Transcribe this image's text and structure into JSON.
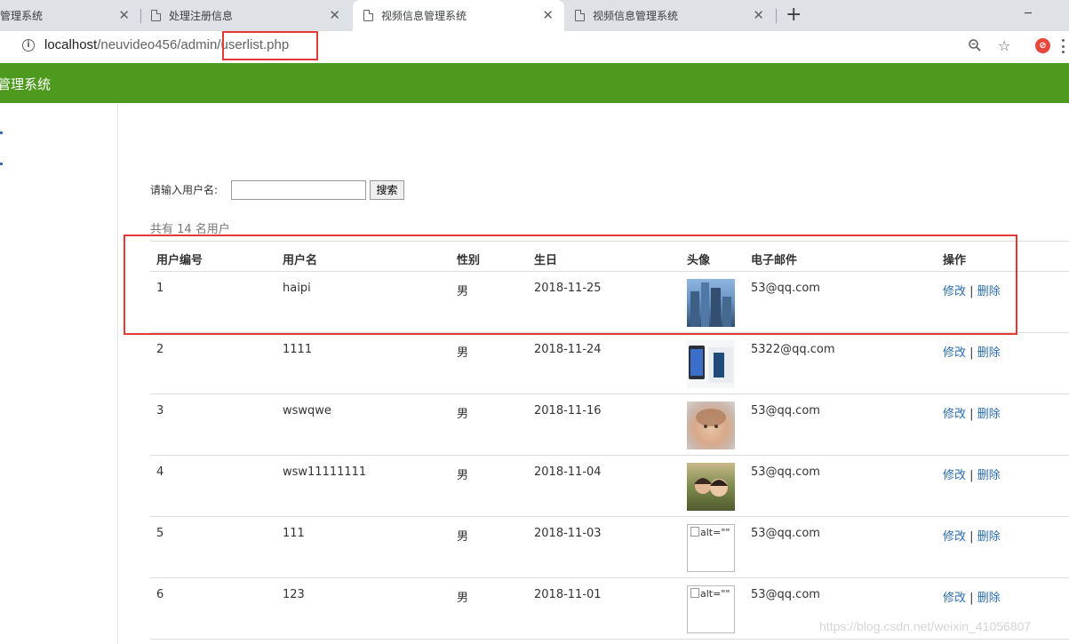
{
  "browser": {
    "tabs": [
      {
        "title": "管理系统",
        "active": false
      },
      {
        "title": "处理注册信息",
        "active": false
      },
      {
        "title": "视频信息管理系统",
        "active": true
      },
      {
        "title": "视频信息管理系统",
        "active": false
      }
    ],
    "url_host": "localhost",
    "url_path": "/neuvideo456/admin/userlist.php"
  },
  "app": {
    "title": "管理系统",
    "header_color": "#4e9a1e"
  },
  "search": {
    "label": "请输入用户名:",
    "value": "",
    "button": "搜索"
  },
  "summary": "共有 14 名用户",
  "table": {
    "headers": [
      "用户编号",
      "用户名",
      "性别",
      "生日",
      "头像",
      "电子邮件",
      "操作"
    ],
    "rows": [
      {
        "id": "1",
        "username": "haipi",
        "gender": "男",
        "birthday": "2018-11-25",
        "avatar": "city-buildings",
        "email": "53@qq.com",
        "edit": "修改",
        "sep": "|",
        "delete": "删除"
      },
      {
        "id": "2",
        "username": "1111",
        "gender": "男",
        "birthday": "2018-11-24",
        "avatar": "phone-screenshot",
        "email": "5322@qq.com",
        "edit": "修改",
        "sep": "|",
        "delete": "删除"
      },
      {
        "id": "3",
        "username": "wswqwe",
        "gender": "男",
        "birthday": "2018-11-16",
        "avatar": "baby-photo",
        "email": "53@qq.com",
        "edit": "修改",
        "sep": "|",
        "delete": "删除"
      },
      {
        "id": "4",
        "username": "wsw11111111",
        "gender": "男",
        "birthday": "2018-11-04",
        "avatar": "girls-outdoor",
        "email": "53@qq.com",
        "edit": "修改",
        "sep": "|",
        "delete": "删除"
      },
      {
        "id": "5",
        "username": "111",
        "gender": "男",
        "birthday": "2018-11-03",
        "avatar_alt": "alt=\"\"",
        "email": "53@qq.com",
        "edit": "修改",
        "sep": "|",
        "delete": "删除"
      },
      {
        "id": "6",
        "username": "123",
        "gender": "男",
        "birthday": "2018-11-01",
        "avatar_alt": "alt=\"\"",
        "email": "53@qq.com",
        "edit": "修改",
        "sep": "|",
        "delete": "删除"
      }
    ]
  },
  "watermark": "https://blog.csdn.net/weixin_41056807"
}
